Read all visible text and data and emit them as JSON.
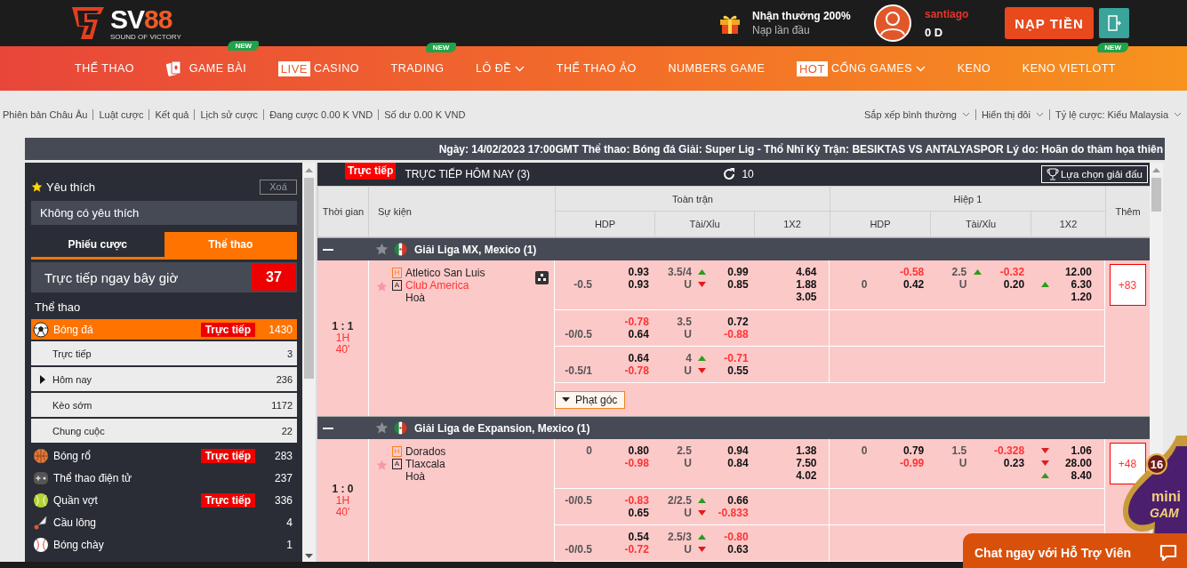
{
  "header": {
    "logo": {
      "name_a": "SV",
      "name_b": "88",
      "tagline": "SOUND OF VICTORY"
    },
    "promo": {
      "title": "Nhận thưởng 200%",
      "subtitle": "Nạp lần đầu"
    },
    "user": {
      "name": "santiago",
      "balance": "0 D"
    },
    "deposit_button": "NẠP TIỀN"
  },
  "nav": [
    {
      "kind": "plain",
      "label": "THỂ THAO",
      "dropdown": false
    },
    {
      "kind": "cards",
      "label": "GAME BÀI",
      "badge": "NEW",
      "dropdown": false
    },
    {
      "kind": "plain",
      "tag": "LIVE",
      "label": "CASINO",
      "dropdown": false
    },
    {
      "kind": "plain",
      "label": "TRADING",
      "badge": "NEW",
      "dropdown": false
    },
    {
      "kind": "plain",
      "label": "LÔ ĐỀ",
      "dropdown": true
    },
    {
      "kind": "plain",
      "label": "THỂ THAO ẢO",
      "dropdown": false
    },
    {
      "kind": "plain",
      "label": "NUMBERS GAME",
      "dropdown": false
    },
    {
      "kind": "plain",
      "tag": "HOT",
      "label": "CỔNG GAMES",
      "dropdown": true
    },
    {
      "kind": "plain",
      "label": "KENO",
      "dropdown": false
    },
    {
      "kind": "plain",
      "label": "KENO VIETLOTT",
      "badge": "NEW",
      "dropdown": false
    }
  ],
  "info_bar": {
    "links": [
      "Phiên bản Châu Âu",
      "Luật cược",
      "Kết quả",
      "Lịch sử cược",
      "Đang cược 0.00 K VND",
      "Số dư 0.00 K VND"
    ],
    "options": [
      "Sắp xếp bình thường",
      "Hiển thị đôi",
      "Tỷ lệ cược: Kiểu Malaysia"
    ]
  },
  "notice": "Ngày: 14/02/2023 17:00GMT Thể thao: Bóng đá Giải: Super Lig - Thổ Nhĩ Kỳ Trận: BESIKTAS VS ANTALYASPOR Lý do: Hoãn do thảm họa thiên",
  "sidebar": {
    "favorites": {
      "title": "Yêu thích",
      "clear_button": "Xoá",
      "empty_text": "Không có yêu thích"
    },
    "tabs": [
      {
        "label": "Phiếu cược",
        "selected": false
      },
      {
        "label": "Thể thao",
        "selected": true
      }
    ],
    "live_now": {
      "label": "Trực tiếp ngay bây giờ",
      "count": "37"
    },
    "section_title": "Thể thao",
    "sports": [
      {
        "kind": "soccer",
        "name": "Bóng đá",
        "live": "Trực tiếp",
        "count": "1430",
        "selected": true,
        "children": [
          {
            "name": "Trực tiếp",
            "count": "3",
            "selected": false
          },
          {
            "name": "Hôm nay",
            "count": "236",
            "selected": true
          },
          {
            "name": "Kèo sớm",
            "count": "1172",
            "selected": false
          },
          {
            "name": "Chung cuộc",
            "count": "22",
            "selected": false
          }
        ]
      },
      {
        "kind": "basketball",
        "name": "Bóng rổ",
        "live": "Trực tiếp",
        "count": "283",
        "selected": false
      },
      {
        "kind": "esports",
        "name": "Thể thao điện tử",
        "count": "237",
        "selected": false
      },
      {
        "kind": "tennis",
        "name": "Quần vợt",
        "live": "Trực tiếp",
        "count": "336",
        "selected": false
      },
      {
        "kind": "badminton",
        "name": "Cầu lông",
        "count": "4",
        "selected": false
      },
      {
        "kind": "baseball",
        "name": "Bóng chày",
        "count": "1",
        "selected": false
      }
    ]
  },
  "table": {
    "live_badge": "Trực tiếp",
    "title": "TRỰC TIẾP HÔM NAY (3)",
    "refresh_count": "10",
    "league_button": "Lựa chọn giải đấu",
    "columns": {
      "time": "Thời gian",
      "event": "Sự kiện",
      "full": "Toàn trận",
      "half": "Hiệp 1",
      "more": "Thêm",
      "hdp": "HDP",
      "ou": "Tài/Xỉu",
      "x12": "1X2",
      "hdp_2": "HDP",
      "ou_2": "Tài/Xỉu",
      "x12_2": "1X2"
    },
    "leagues": [
      {
        "name": "Giải Liga MX, Mexico (1)",
        "expanded": true,
        "favorite": false,
        "matches": [
          {
            "score": "1 : 1",
            "period": "1H",
            "minute": "40'",
            "favorite": false,
            "stats": true,
            "teams": [
              {
                "side": "H",
                "name": "Atletico San Luis",
                "highlighted": false
              },
              {
                "side": "A",
                "name": "Club America",
                "highlighted": true
              }
            ],
            "draw": "Hoà",
            "lines": [
              {
                "hdp": {
                  "top": {
                    "odds": {
                      "value": "0.93",
                      "negative": false
                    }
                  },
                  "bottom": {
                    "label": "-0.5",
                    "odds": {
                      "value": "0.93",
                      "negative": false
                    }
                  }
                },
                "ou": {
                  "top": {
                    "label": "3.5/4",
                    "odds": {
                      "value": "0.99",
                      "negative": false,
                      "rising": true
                    }
                  },
                  "bottom": {
                    "label": "U",
                    "odds": {
                      "value": "0.85",
                      "negative": false,
                      "rising": false
                    }
                  }
                },
                "x12": [
                  {
                    "value": "4.64",
                    "negative": false
                  },
                  {
                    "value": "1.88",
                    "negative": false
                  },
                  {
                    "value": "3.05",
                    "negative": false
                  }
                ],
                "half": {
                  "hdp": {
                    "top": {
                      "odds": {
                        "value": "-0.58",
                        "negative": true
                      }
                    },
                    "bottom": {
                      "label": "0",
                      "odds": {
                        "value": "0.42",
                        "negative": false
                      }
                    }
                  },
                  "ou": {
                    "top": {
                      "label": "2.5",
                      "odds": {
                        "value": "-0.32",
                        "negative": true,
                        "rising": true
                      }
                    },
                    "bottom": {
                      "label": "U",
                      "odds": {
                        "value": "0.20",
                        "negative": false
                      }
                    }
                  },
                  "x12": [
                    {
                      "value": "12.00",
                      "negative": false
                    },
                    {
                      "value": "6.30",
                      "negative": false,
                      "rising": true
                    },
                    {
                      "value": "1.20",
                      "negative": false
                    }
                  ]
                }
              },
              {
                "hdp": {
                  "top": {
                    "odds": {
                      "value": "-0.78",
                      "negative": true
                    }
                  },
                  "bottom": {
                    "label": "-0/0.5",
                    "odds": {
                      "value": "0.64",
                      "negative": false
                    }
                  }
                },
                "ou": {
                  "top": {
                    "label": "3.5",
                    "odds": {
                      "value": "0.72",
                      "negative": false
                    }
                  },
                  "bottom": {
                    "label": "U",
                    "odds": {
                      "value": "-0.88",
                      "negative": true
                    }
                  }
                }
              },
              {
                "hdp": {
                  "top": {
                    "odds": {
                      "value": "0.64",
                      "negative": false
                    }
                  },
                  "bottom": {
                    "label": "-0.5/1",
                    "odds": {
                      "value": "-0.78",
                      "negative": true
                    }
                  }
                },
                "ou": {
                  "top": {
                    "label": "4",
                    "odds": {
                      "value": "-0.71",
                      "negative": true,
                      "rising": true
                    }
                  },
                  "bottom": {
                    "label": "U",
                    "odds": {
                      "value": "0.55",
                      "negative": false,
                      "rising": false
                    }
                  }
                }
              }
            ],
            "more": "+83",
            "extra_button": "Phạt góc"
          }
        ]
      },
      {
        "name": "Giải Liga de Expansion, Mexico (1)",
        "expanded": true,
        "favorite": false,
        "matches": [
          {
            "score": "1 : 0",
            "period": "1H",
            "minute": "40'",
            "favorite": false,
            "stats": false,
            "teams": [
              {
                "side": "H",
                "name": "Dorados",
                "highlighted": false
              },
              {
                "side": "A",
                "name": "Tlaxcala",
                "highlighted": false
              }
            ],
            "draw": "Hoà",
            "lines": [
              {
                "hdp": {
                  "top": {
                    "label": "0",
                    "odds": {
                      "value": "0.80",
                      "negative": false
                    }
                  },
                  "bottom": {
                    "odds": {
                      "value": "-0.98",
                      "negative": true
                    }
                  }
                },
                "ou": {
                  "top": {
                    "label": "2.5",
                    "odds": {
                      "value": "0.94",
                      "negative": false
                    }
                  },
                  "bottom": {
                    "label": "U",
                    "odds": {
                      "value": "0.84",
                      "negative": false
                    }
                  }
                },
                "x12": [
                  {
                    "value": "1.38",
                    "negative": false
                  },
                  {
                    "value": "7.50",
                    "negative": false
                  },
                  {
                    "value": "4.02",
                    "negative": false
                  }
                ],
                "half": {
                  "hdp": {
                    "top": {
                      "label": "0",
                      "odds": {
                        "value": "0.79",
                        "negative": false
                      }
                    },
                    "bottom": {
                      "odds": {
                        "value": "-0.99",
                        "negative": true
                      }
                    }
                  },
                  "ou": {
                    "top": {
                      "label": "1.5",
                      "odds": {
                        "value": "-0.328",
                        "negative": true
                      }
                    },
                    "bottom": {
                      "label": "U",
                      "odds": {
                        "value": "0.23",
                        "negative": false
                      }
                    }
                  },
                  "x12": [
                    {
                      "value": "1.06",
                      "negative": false,
                      "rising": false
                    },
                    {
                      "value": "28.00",
                      "negative": false,
                      "rising": false
                    },
                    {
                      "value": "8.40",
                      "negative": false,
                      "rising": true
                    }
                  ]
                }
              },
              {
                "hdp": {
                  "top": {
                    "label": "-0/0.5",
                    "odds": {
                      "value": "-0.83",
                      "negative": true
                    }
                  },
                  "bottom": {
                    "odds": {
                      "value": "0.65",
                      "negative": false
                    }
                  }
                },
                "ou": {
                  "top": {
                    "label": "2/2.5",
                    "odds": {
                      "value": "0.66",
                      "negative": false,
                      "rising": true
                    }
                  },
                  "bottom": {
                    "label": "U",
                    "odds": {
                      "value": "-0.833",
                      "negative": true,
                      "rising": false
                    }
                  }
                }
              },
              {
                "hdp": {
                  "top": {
                    "odds": {
                      "value": "0.54",
                      "negative": false
                    }
                  },
                  "bottom": {
                    "label": "-0/0.5",
                    "odds": {
                      "value": "-0.72",
                      "negative": true
                    }
                  }
                },
                "ou": {
                  "top": {
                    "label": "2.5/3",
                    "odds": {
                      "value": "-0.80",
                      "negative": true,
                      "rising": true
                    }
                  },
                  "bottom": {
                    "label": "U",
                    "odds": {
                      "value": "0.63",
                      "negative": false,
                      "rising": false
                    }
                  }
                }
              }
            ],
            "more": "+48"
          }
        ]
      }
    ]
  },
  "mini_game": {
    "count": "16",
    "line_1": "mini",
    "line_2": "GAM"
  },
  "chat_button": "Chat ngay với Hỗ Trợ Viên"
}
